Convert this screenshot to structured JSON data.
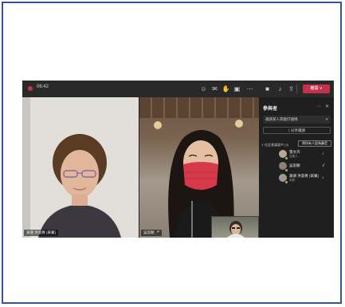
{
  "call": {
    "timer": "06:42",
    "leave_label": "離開"
  },
  "toolbar": {
    "icons": [
      "people-icon",
      "chat-icon",
      "reactions-icon",
      "rooms-icon",
      "more-icon",
      "camera-icon",
      "mic-icon",
      "share-icon"
    ]
  },
  "tiles": {
    "left_name": "謝謝 洪淑菁 (來賓)",
    "right_name": "吳思穎 🎤"
  },
  "panel": {
    "title": "參與者",
    "search_placeholder": "邀請某人或撥打號碼",
    "share_label": "⟨ 分享邀請",
    "section_label": "∨ 在此會議當中 (3)",
    "mute_all_label": "將所有人設為靜音",
    "participants": [
      {
        "name": "張文卉",
        "role": "召集人"
      },
      {
        "name": "吳思穎",
        "role": ""
      },
      {
        "name": "謝謝 洪淑菁 (來賓)",
        "role": "來賓"
      }
    ]
  }
}
